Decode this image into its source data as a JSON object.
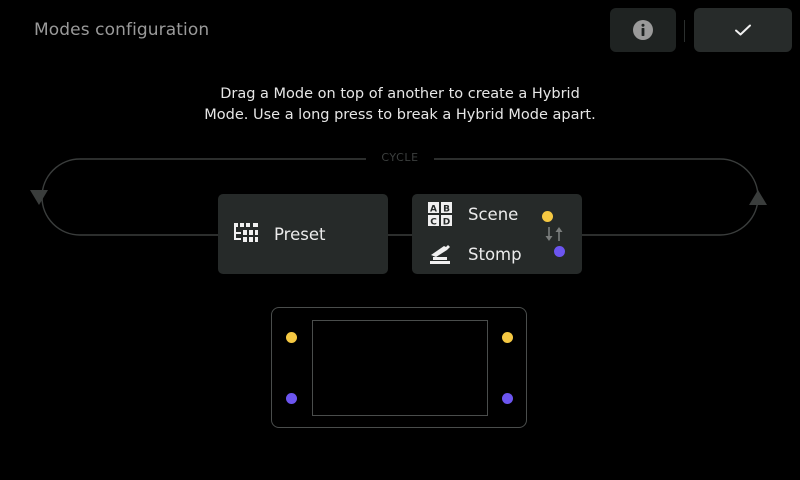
{
  "header": {
    "title": "Modes configuration",
    "info_icon": "info-icon",
    "confirm_icon": "checkmark-icon"
  },
  "instructions": {
    "line1": "Drag a Mode on top of another to create a Hybrid",
    "line2": "Mode. Use a long press to break a Hybrid Mode apart."
  },
  "cycle": {
    "label": "CYCLE"
  },
  "modes": {
    "preset": {
      "label": "Preset",
      "icon": "preset-icon"
    },
    "hybrid": {
      "top": {
        "label": "Scene",
        "icon": "scene-abcd-icon",
        "dot_color": "#f5c842"
      },
      "bottom": {
        "label": "Stomp",
        "icon": "stomp-footswitch-icon",
        "dot_color": "#6c55f0"
      },
      "swap_icon": "swap-arrows-icon"
    }
  },
  "colors": {
    "background": "#000000",
    "card": "#262a29",
    "accent_yellow": "#f5c842",
    "accent_purple": "#6c55f0",
    "muted_text": "#9a9a9a"
  },
  "device_preview": {
    "footswitches": [
      {
        "position": "top-left",
        "color": "#f5c842"
      },
      {
        "position": "top-right",
        "color": "#f5c842"
      },
      {
        "position": "bottom-left",
        "color": "#6c55f0"
      },
      {
        "position": "bottom-right",
        "color": "#6c55f0"
      }
    ]
  }
}
